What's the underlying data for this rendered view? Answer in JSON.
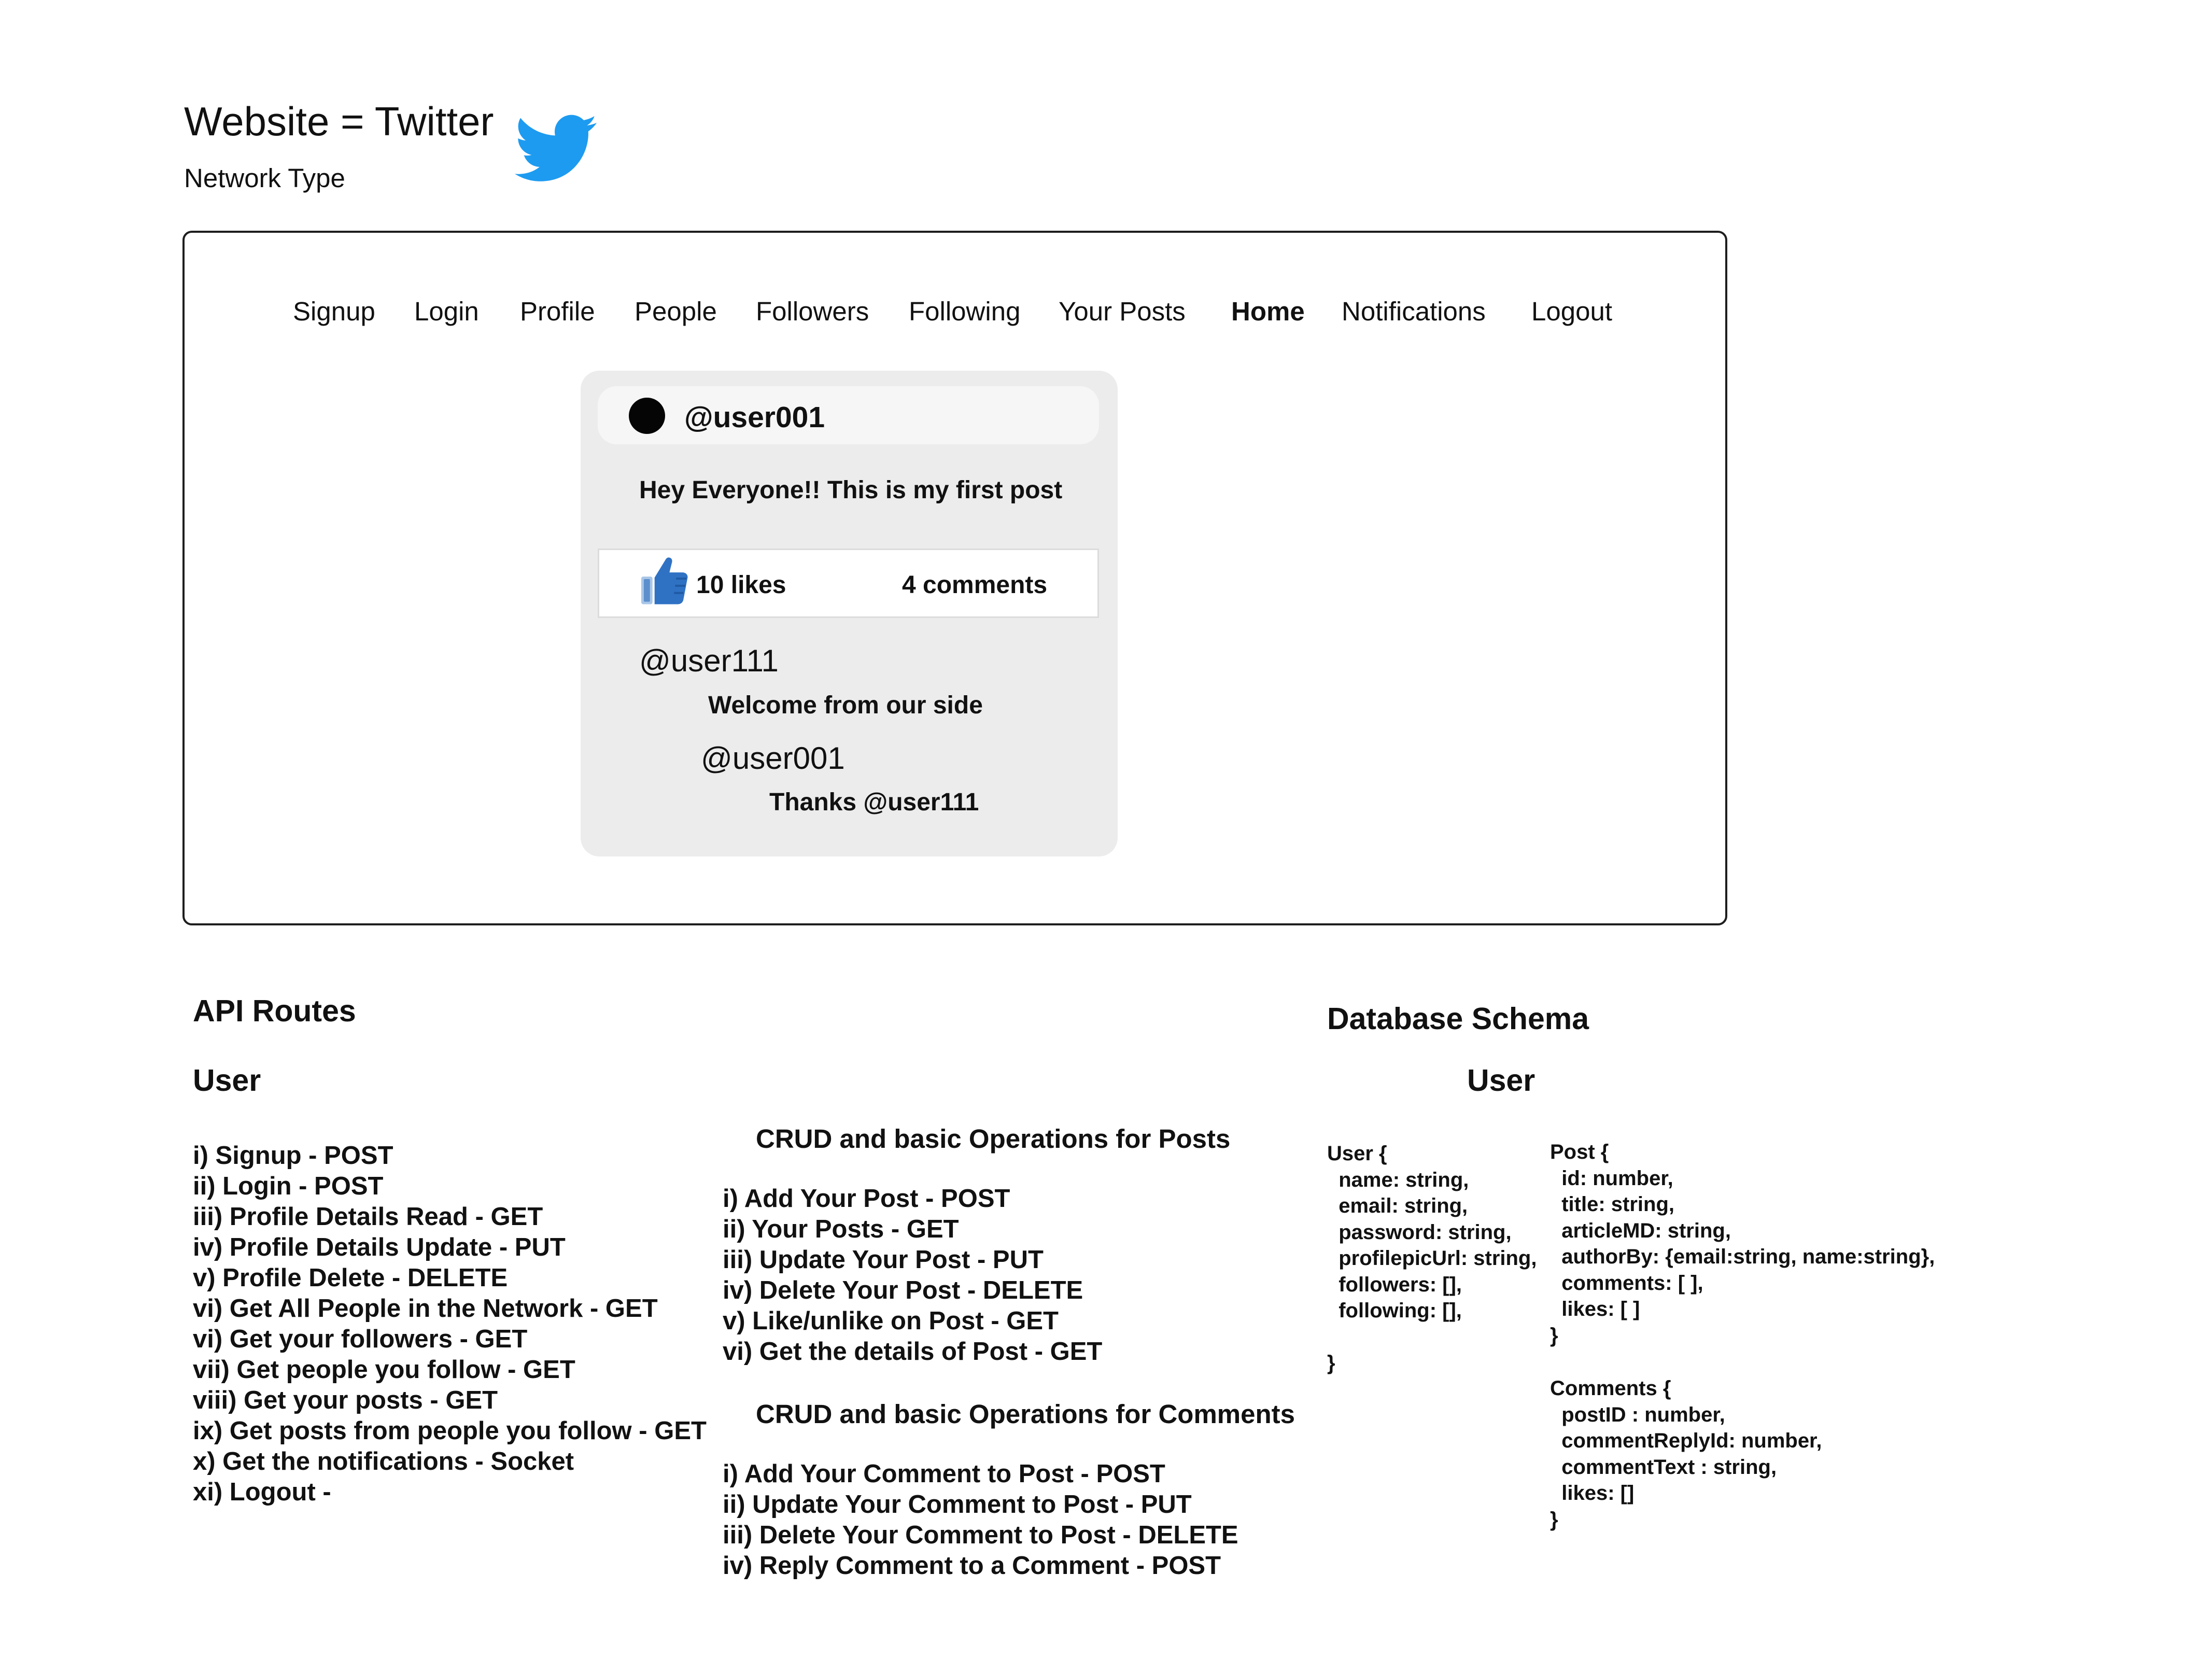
{
  "header": {
    "title": "Website = Twitter",
    "subtitle": "Network Type",
    "brand_color": "#1d9bf0",
    "logo_icon": "twitter-bird-icon"
  },
  "nav": {
    "items": [
      {
        "label": "Signup"
      },
      {
        "label": "Login"
      },
      {
        "label": "Profile"
      },
      {
        "label": "People"
      },
      {
        "label": "Followers"
      },
      {
        "label": "Following"
      },
      {
        "label": "Your Posts"
      },
      {
        "label": "Home",
        "active": true
      },
      {
        "label": "Notifications"
      },
      {
        "label": "Logout"
      }
    ]
  },
  "post": {
    "author": "@user001",
    "text": "Hey Everyone!! This is my first post",
    "likes": "10 likes",
    "comments": "4 comments",
    "like_icon": "thumbs-up-icon",
    "like_color": "#2f72c4",
    "thread": [
      {
        "author": "@user111",
        "text": "Welcome from our side"
      },
      {
        "author": "@user001",
        "text": "Thanks @user111"
      }
    ]
  },
  "api": {
    "title": "API Routes",
    "user_heading": "User",
    "user_routes": [
      "i) Signup - POST",
      "ii) Login - POST",
      "iii) Profile Details Read - GET",
      "iv) Profile Details Update - PUT",
      "v) Profile Delete - DELETE",
      "vi) Get All People in the Network - GET",
      "vi) Get your followers - GET",
      "vii) Get people you follow - GET",
      "viii) Get your posts - GET",
      "ix) Get posts from people you follow - GET",
      "x) Get the notifications - Socket",
      "xi) Logout -"
    ],
    "posts_heading": "CRUD and basic Operations for Posts",
    "post_routes": [
      "i) Add Your Post - POST",
      "ii) Your Posts - GET",
      "iii) Update  Your Post - PUT",
      "iv) Delete Your Post - DELETE",
      "v) Like/unlike on Post - GET",
      "vi) Get the details of Post - GET"
    ],
    "comments_heading": "CRUD and basic Operations for Comments",
    "comment_routes": [
      "i) Add Your Comment to Post - POST",
      "ii) Update Your Comment to Post - PUT",
      "iii) Delete Your Comment to Post - DELETE",
      "iv) Reply Comment to a Comment - POST"
    ]
  },
  "schema": {
    "title": "Database Schema",
    "user_heading": "User",
    "user_block": "User {\n  name: string,\n  email: string,\n  password: string,\n  profilepicUrl: string,\n  followers: [],\n  following: [],\n\n}",
    "post_block": "Post {\n  id: number,\n  title: string,\n  articleMD: string,\n  authorBy: {email:string, name:string},\n  comments: [ ],\n  likes: [ ]\n}",
    "comments_block": "Comments {\n  postID : number,\n  commentReplyId: number,\n  commentText : string,\n  likes: []\n}"
  }
}
